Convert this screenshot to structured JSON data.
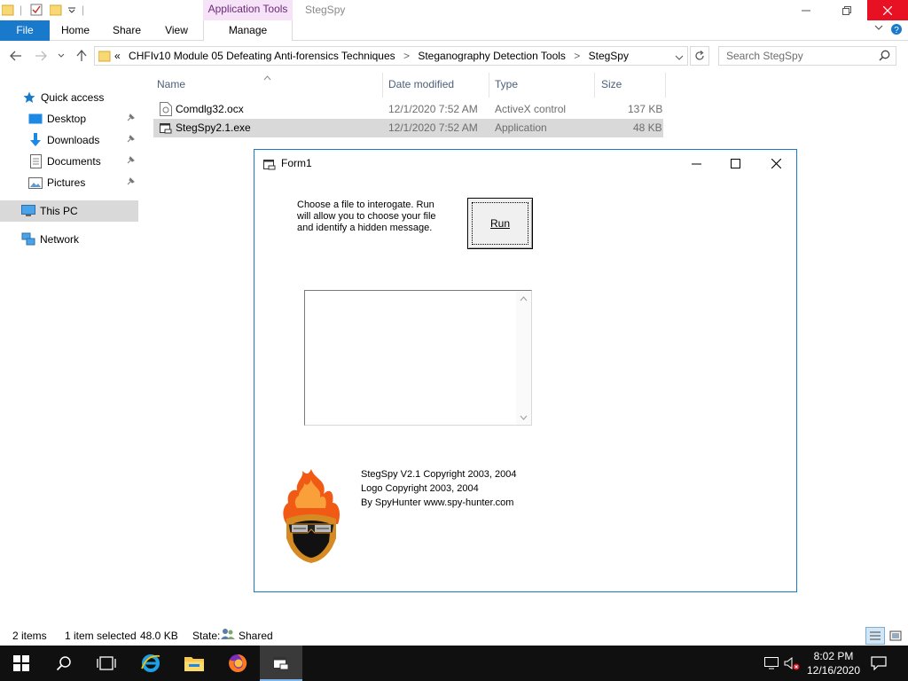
{
  "window": {
    "title": "StegSpy",
    "contextual_tab_header": "Application Tools"
  },
  "ribbon": {
    "tabs": [
      "File",
      "Home",
      "Share",
      "View",
      "Manage"
    ]
  },
  "address": {
    "overflow": "«",
    "crumbs": [
      "CHFIv10 Module 05 Defeating Anti-forensics Techniques",
      "Steganography Detection Tools",
      "StegSpy"
    ],
    "separator": ">"
  },
  "search": {
    "placeholder": "Search StegSpy"
  },
  "nav_pane": {
    "items": [
      {
        "label": "Quick access",
        "icon": "star-icon"
      },
      {
        "label": "Desktop",
        "icon": "desktop-icon",
        "pinned": true
      },
      {
        "label": "Downloads",
        "icon": "download-arrow-icon",
        "pinned": true
      },
      {
        "label": "Documents",
        "icon": "documents-icon",
        "pinned": true
      },
      {
        "label": "Pictures",
        "icon": "pictures-icon",
        "pinned": true
      },
      {
        "label": "This PC",
        "icon": "computer-icon"
      },
      {
        "label": "Network",
        "icon": "network-icon"
      }
    ]
  },
  "file_list": {
    "columns": [
      "Name",
      "Date modified",
      "Type",
      "Size"
    ],
    "rows": [
      {
        "name": "Comdlg32.ocx",
        "date": "12/1/2020 7:52 AM",
        "type": "ActiveX control",
        "size": "137 KB"
      },
      {
        "name": "StegSpy2.1.exe",
        "date": "12/1/2020 7:52 AM",
        "type": "Application",
        "size": "48 KB"
      }
    ]
  },
  "status_bar": {
    "item_count": "2 items",
    "selection": "1 item selected",
    "selection_size": "48.0 KB",
    "state_label": "State:",
    "state_value": "Shared"
  },
  "form1": {
    "title": "Form1",
    "instructions": "Choose a file to interogate. Run will allow you to choose your file and identify a hidden message.",
    "run_label": "Run",
    "output_value": "",
    "credits": [
      "StegSpy V2.1 Copyright 2003, 2004",
      "Logo Copyright 2003, 2004",
      "By SpyHunter www.spy-hunter.com"
    ]
  },
  "taskbar": {
    "clock_time": "8:02 PM",
    "clock_date": "12/16/2020"
  },
  "colors": {
    "file_tab": "#1979ca",
    "contextual_tab": "#f6e3f8",
    "close_button": "#e81123",
    "taskbar": "#101010",
    "selection": "#d9d9d9"
  }
}
